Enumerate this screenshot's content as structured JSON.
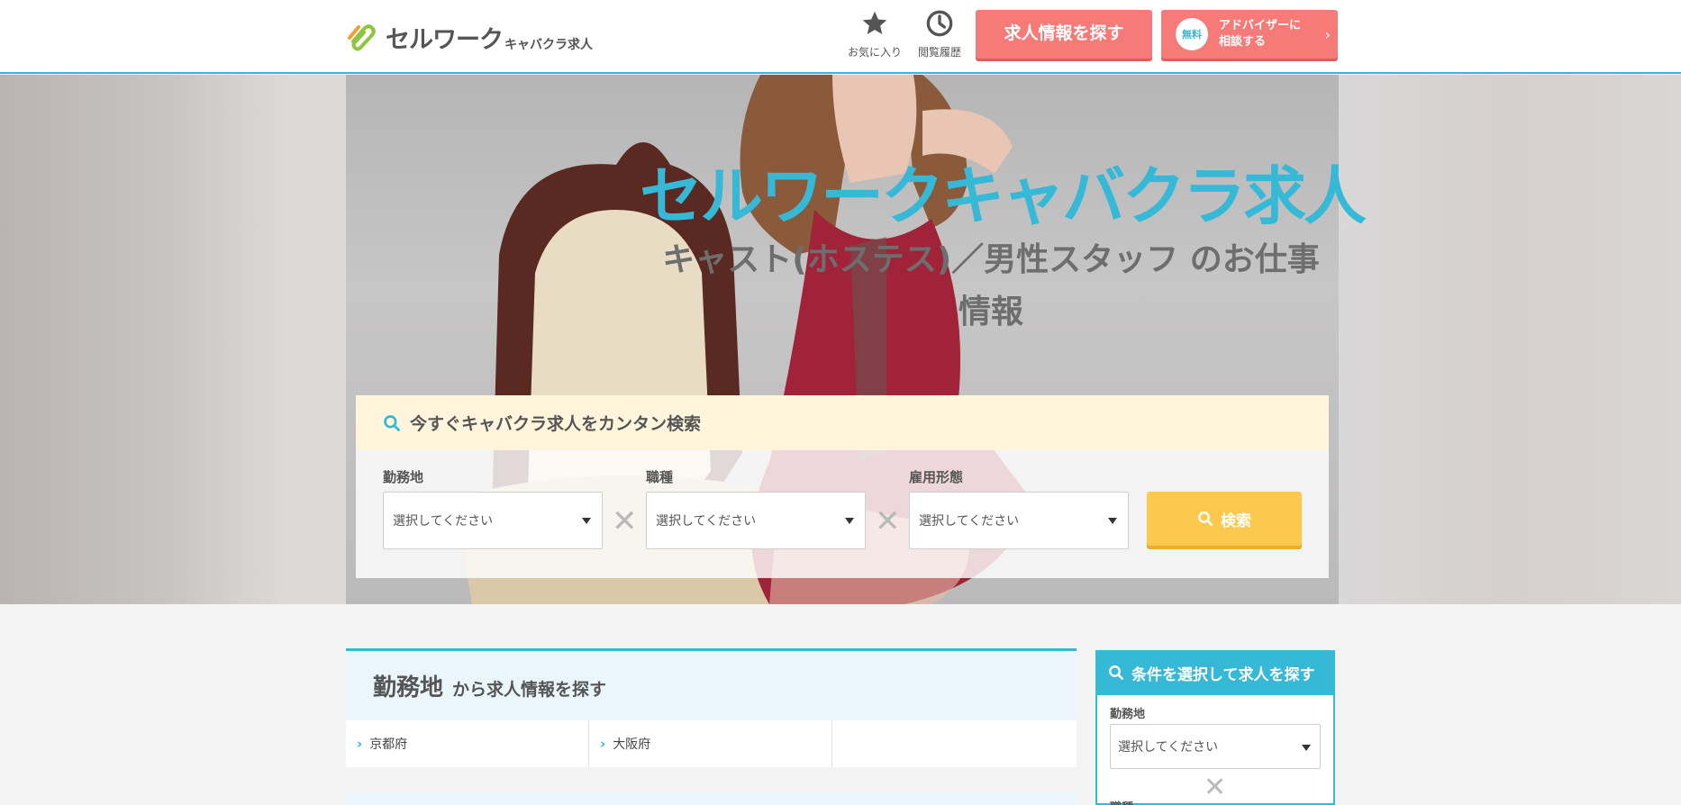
{
  "header": {
    "logo_main": "セルワーク",
    "logo_sub": "キャバクラ求人",
    "favorites_label": "お気に入り",
    "history_label": "閲覧履歴",
    "search_jobs_label": "求人情報を探す",
    "advisor_badge": "無料",
    "advisor_line1": "アドバイザーに",
    "advisor_line2": "相談する",
    "accent_color": "#35b9d6",
    "button_color": "#f57a78"
  },
  "hero": {
    "title": "セルワークキャバクラ求人",
    "subtitle": "キャスト(ホステス)／男性スタッフ のお仕事情報"
  },
  "search": {
    "heading": "今すぐキャバクラ求人をカンタン検索",
    "fields": [
      {
        "label": "勤務地",
        "value": "選択してください"
      },
      {
        "label": "職種",
        "value": "選択してください"
      },
      {
        "label": "雇用形態",
        "value": "選択してください"
      }
    ],
    "button_label": "検索",
    "button_color": "#fcc84d"
  },
  "area": {
    "heading_big": "勤務地",
    "heading_small": "から求人情報を探す",
    "items": [
      "京都府",
      "大阪府",
      ""
    ]
  },
  "sidebar": {
    "heading": "条件を選択して求人を探す",
    "field1_label": "勤務地",
    "field1_value": "選択してください",
    "field2_label": "職種"
  }
}
